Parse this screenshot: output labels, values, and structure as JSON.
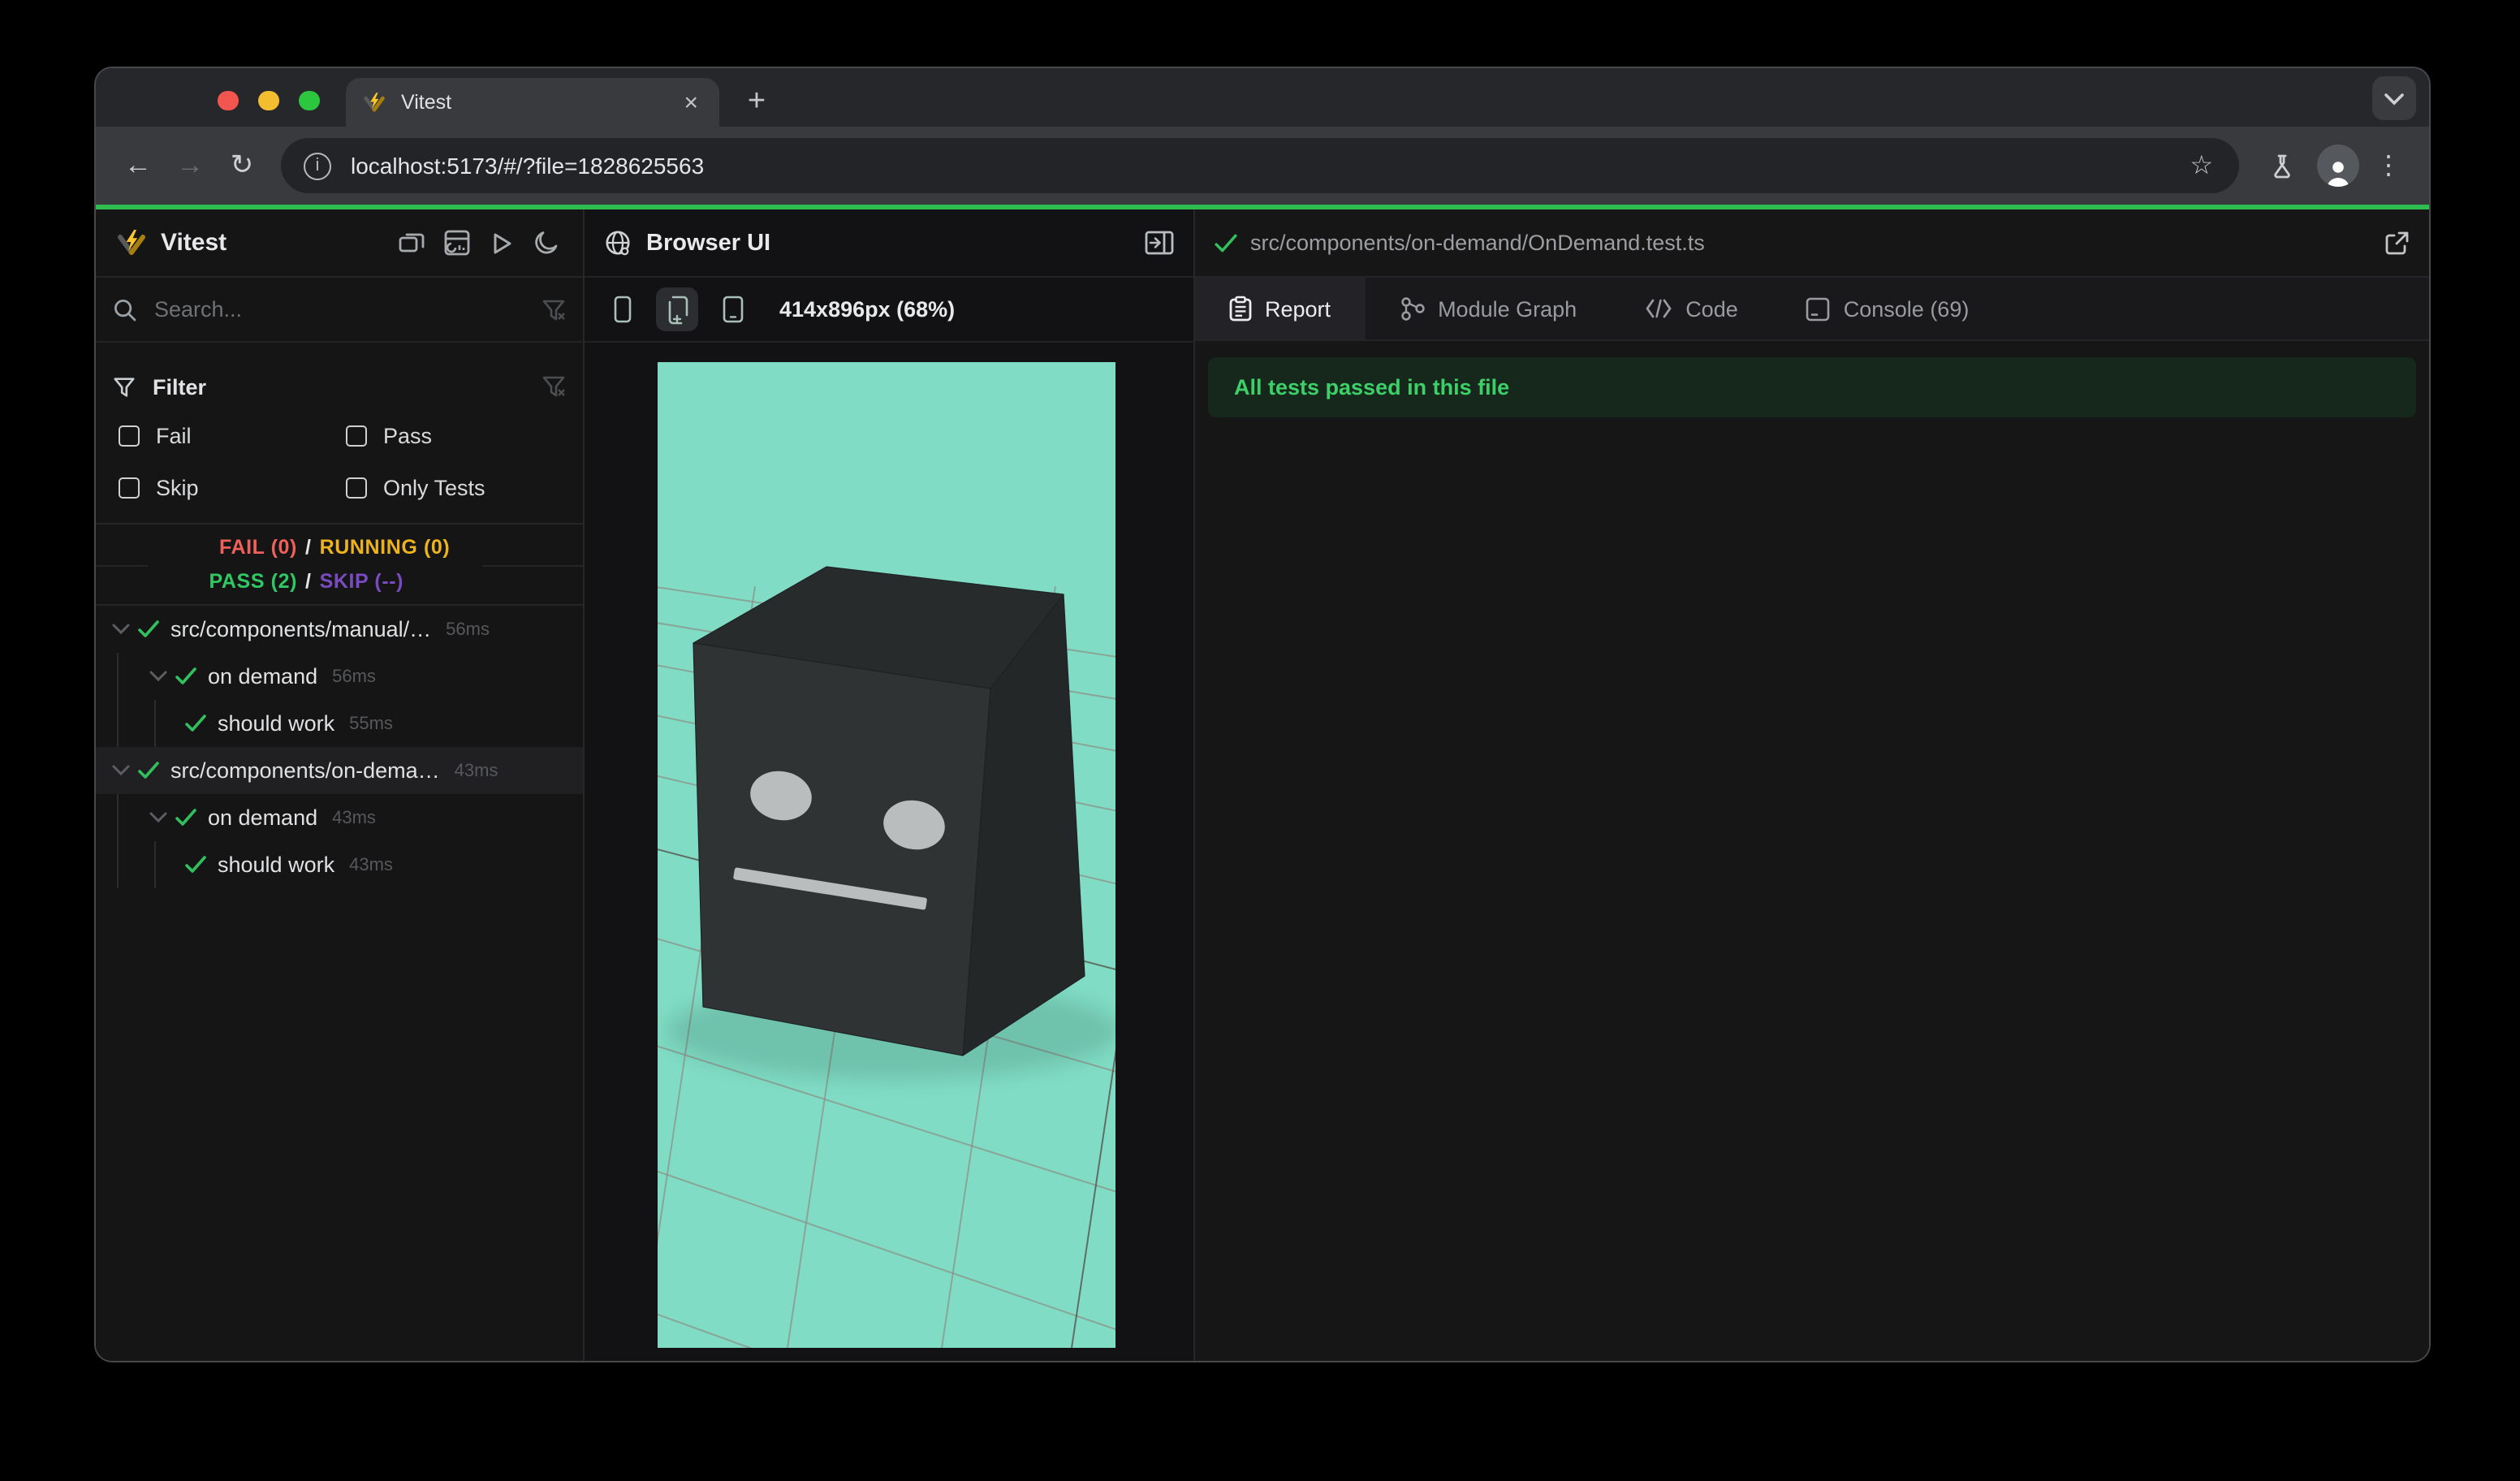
{
  "colors": {
    "accent_green": "#2ebd4e",
    "mint": "#80dcc4",
    "fail": "#f0605a",
    "running": "#edb31f",
    "pass": "#2fc862",
    "skip": "#7a4bc0",
    "check_green": "#31c05e",
    "banner_bg": "#16281c",
    "banner_text": "#3dd068",
    "selected_row": "#202023",
    "traffic_red": "#f2554d",
    "traffic_yellow": "#f4bd2f",
    "traffic_green": "#2dc63f"
  },
  "window": {
    "tab_title": "Vitest",
    "close_glyph": "×",
    "new_tab_glyph": "+",
    "toolbar": {
      "back_glyph": "←",
      "forward_glyph": "→",
      "reload_glyph": "↻",
      "url": "localhost:5173/#/?file=1828625563",
      "info_glyph": "i",
      "star_glyph": "☆",
      "menu_glyph": "⋮"
    }
  },
  "sidebar": {
    "title": "Vitest",
    "search_placeholder": "Search...",
    "filter": {
      "title": "Filter",
      "options": [
        {
          "label": "Fail"
        },
        {
          "label": "Pass"
        },
        {
          "label": "Skip"
        },
        {
          "label": "Only Tests"
        }
      ]
    },
    "stats": {
      "fail": "FAIL (0)",
      "sep1": "/",
      "running": "RUNNING (0)",
      "pass": "PASS (2)",
      "sep2": "/",
      "skip": "SKIP (--)"
    },
    "tree": [
      {
        "label": "src/components/manual/…",
        "duration": "56ms"
      },
      {
        "label": "on demand",
        "duration": "56ms"
      },
      {
        "label": "should work",
        "duration": "55ms"
      },
      {
        "label": "src/components/on-dema…",
        "duration": "43ms"
      },
      {
        "label": "on demand",
        "duration": "43ms"
      },
      {
        "label": "should work",
        "duration": "43ms"
      }
    ]
  },
  "browser_panel": {
    "title": "Browser UI",
    "dimensions": "414x896px (68%)"
  },
  "report_panel": {
    "file_path": "src/components/on-demand/OnDemand.test.ts",
    "tabs": [
      {
        "label": "Report"
      },
      {
        "label": "Module Graph"
      },
      {
        "label": "Code"
      },
      {
        "label": "Console (69)"
      }
    ],
    "banner": "All tests passed in this file"
  }
}
